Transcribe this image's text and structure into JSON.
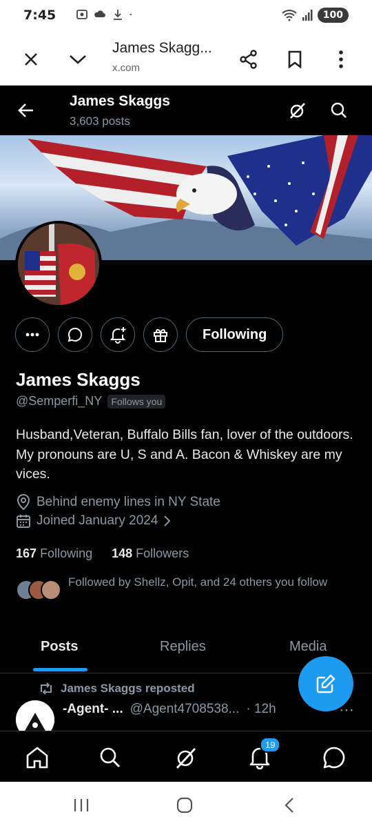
{
  "status_bar": {
    "time": "7:45",
    "battery": "100"
  },
  "browser_bar": {
    "title": "James Skagg...",
    "url": "x.com"
  },
  "header": {
    "name": "James Skaggs",
    "posts_count": "3,603 posts"
  },
  "profile": {
    "name": "James Skaggs",
    "handle": "@Semperfi_NY",
    "follows_you": "Follows you",
    "following_button": "Following",
    "bio": "Husband,Veteran, Buffalo Bills fan, lover of the outdoors. My pronouns are U, S and A. Bacon & Whiskey are my vices.",
    "location": "Behind enemy lines in NY State",
    "joined": "Joined January 2024",
    "following_count": "167",
    "following_label": "Following",
    "followers_count": "148",
    "followers_label": "Followers",
    "followed_by": "Followed by Shellz, Opit, and 24 others you follow"
  },
  "tabs": [
    "Posts",
    "Replies",
    "Media"
  ],
  "post": {
    "repost_label": "James Skaggs reposted",
    "author": "-Agent- ...",
    "handle": "@Agent4708538...",
    "time": "· 12h"
  },
  "nav": {
    "notifications_badge": "19"
  },
  "colors": {
    "accent": "#1d9bf0",
    "background": "#000000",
    "secondary_text": "#8b98a5",
    "border": "#2f3336"
  }
}
